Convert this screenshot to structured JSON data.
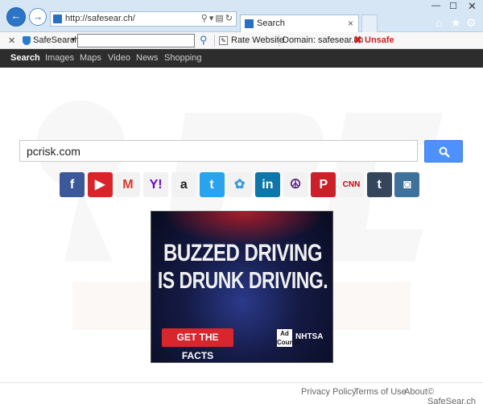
{
  "browser": {
    "url": "http://safesear.ch/",
    "tab_title": "Search",
    "tab_close": "×",
    "back_glyph": "←",
    "forward_glyph": "→"
  },
  "toolbar": {
    "close_glyph": "✕",
    "brand_label": "SafeSearch",
    "rate_label": "Rate Website",
    "domain_label": "Domain: safesear.ch",
    "unsafe_label": "Unsafe"
  },
  "nav": {
    "items": [
      "Search",
      "Images",
      "Maps",
      "Video",
      "News",
      "Shopping"
    ]
  },
  "search": {
    "query": "pcrisk.com"
  },
  "social": [
    {
      "name": "facebook",
      "glyph": "f",
      "color": "#3b5998"
    },
    {
      "name": "youtube",
      "glyph": "▶",
      "color": "#d9252a"
    },
    {
      "name": "gmail",
      "glyph": "M",
      "color": "#f2f2f2"
    },
    {
      "name": "yahoo",
      "glyph": "Y!",
      "color": "#f2f2f2"
    },
    {
      "name": "amazon",
      "glyph": "a",
      "color": "#f2f2f2"
    },
    {
      "name": "twitter",
      "glyph": "t",
      "color": "#2aa3ef"
    },
    {
      "name": "butterfly",
      "glyph": "✿",
      "color": "#f2f2f2"
    },
    {
      "name": "linkedin",
      "glyph": "in",
      "color": "#0e76a8"
    },
    {
      "name": "peace",
      "glyph": "☮",
      "color": "#f2f2f2"
    },
    {
      "name": "pinterest",
      "glyph": "P",
      "color": "#cb2027"
    },
    {
      "name": "cnn",
      "glyph": "CNN",
      "color": "#f2f2f2"
    },
    {
      "name": "tumblr",
      "glyph": "t",
      "color": "#35465c"
    },
    {
      "name": "instagram",
      "glyph": "◙",
      "color": "#3f729b"
    }
  ],
  "ad": {
    "headline_1": "BUZZED DRIVING",
    "headline_2": "IS DRUNK DRIVING.",
    "cta": "GET THE FACTS",
    "council": "Ad Council",
    "nhtsa": "NHTSA"
  },
  "footer": {
    "privacy": "Privacy Policy",
    "terms": "Terms of Use",
    "about": "About",
    "copyright": "© SafeSear.ch"
  }
}
